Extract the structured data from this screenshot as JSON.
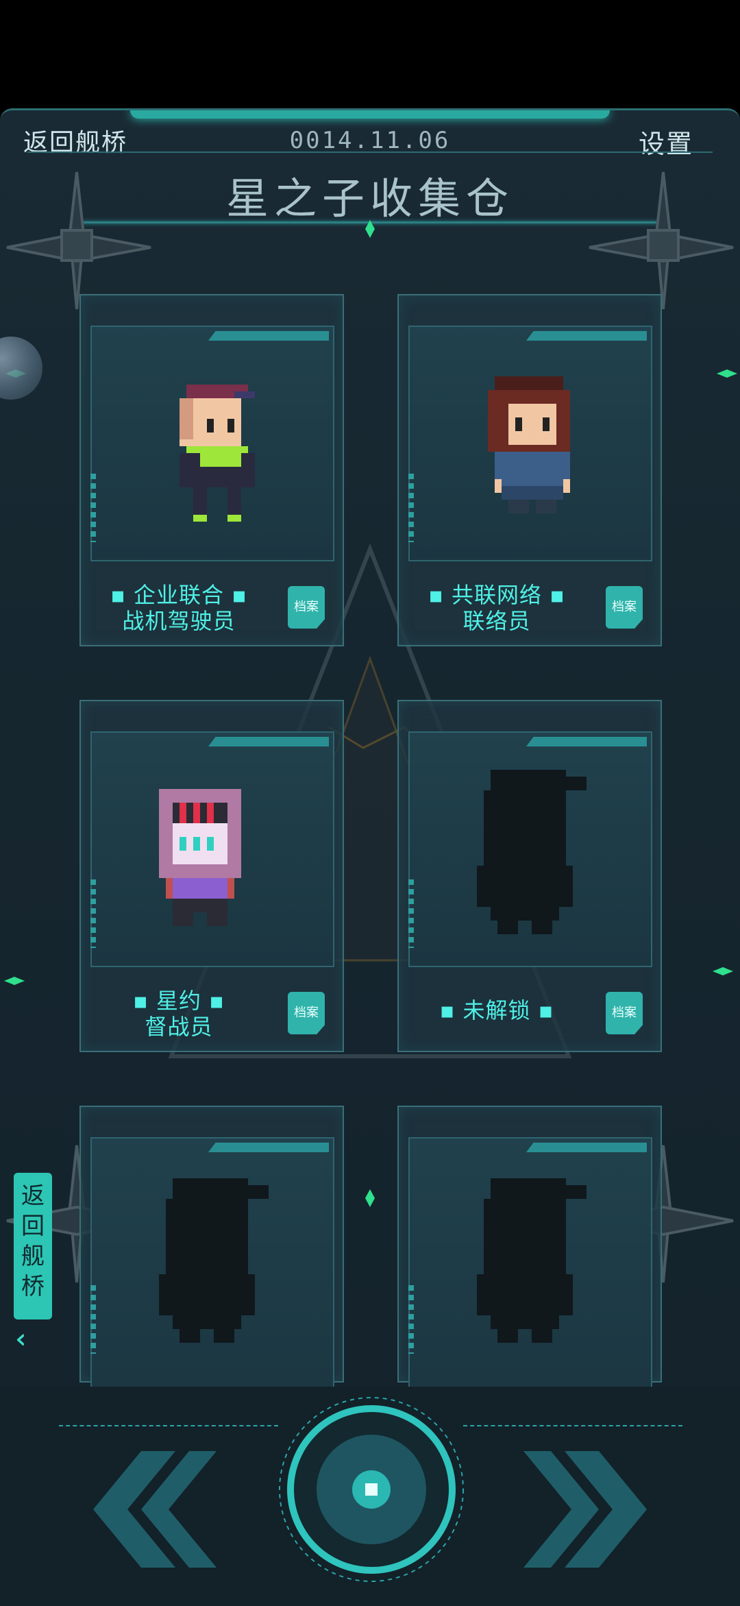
{
  "header": {
    "back_label": "返回舰桥",
    "date": "0014.11.06",
    "settings_label": "设置",
    "title": "星之子收集仓"
  },
  "cards": [
    {
      "line1": "企业联合",
      "line2": "战机驾驶员",
      "file_label": "档案",
      "unlocked": true
    },
    {
      "line1": "共联网络",
      "line2": "联络员",
      "file_label": "档案",
      "unlocked": true
    },
    {
      "line1": "星约",
      "line2": "督战员",
      "file_label": "档案",
      "unlocked": true
    },
    {
      "line1": "未解锁",
      "line2": "",
      "file_label": "档案",
      "unlocked": false
    },
    {
      "line1": "",
      "line2": "",
      "file_label": "",
      "unlocked": false
    },
    {
      "line1": "",
      "line2": "",
      "file_label": "",
      "unlocked": false
    }
  ],
  "side": {
    "back_label": "返回舰桥",
    "chevron": "‹‹"
  },
  "colors": {
    "accent": "#2dc6b4",
    "caption": "#4ff0e6",
    "gem": "#2fe08c",
    "background": "#16262f"
  },
  "icons": {
    "prev": "double-chevron-left-icon",
    "next": "double-chevron-right-icon",
    "center": "center-action-icon"
  }
}
